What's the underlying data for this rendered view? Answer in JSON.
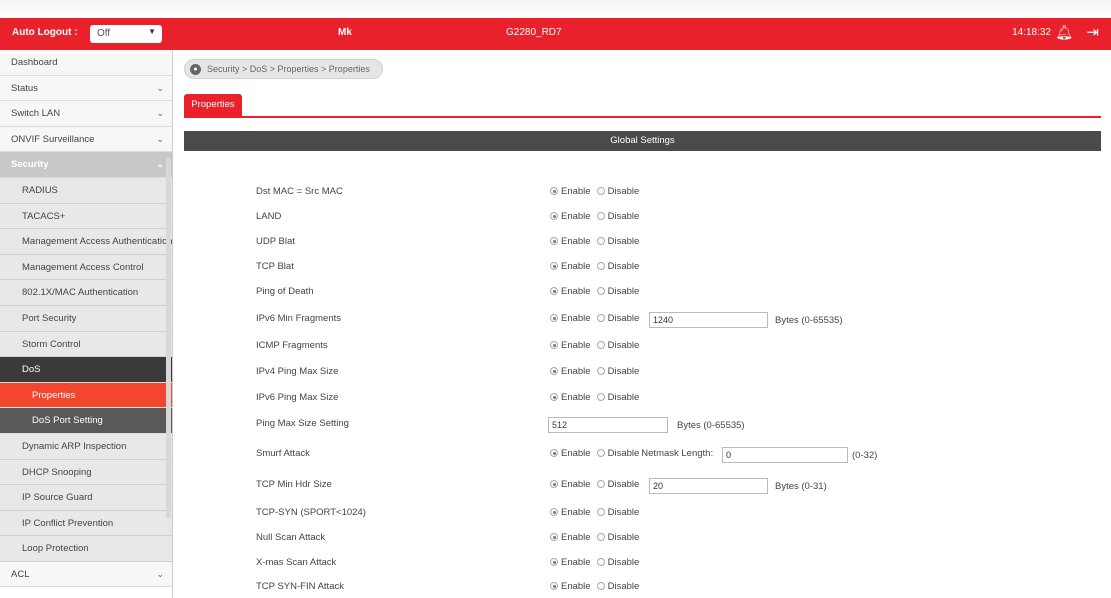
{
  "header": {
    "auto_logout_label": "Auto Logout :",
    "auto_logout_value": "Off",
    "user": "Mk",
    "model": "G2280_RD7",
    "time": "14:18:32"
  },
  "sidebar": {
    "items": [
      {
        "label": "Dashboard",
        "chevron": ""
      },
      {
        "label": "Status",
        "chevron": "⌄"
      },
      {
        "label": "Switch LAN",
        "chevron": "⌄"
      },
      {
        "label": "ONVIF Surveillance",
        "chevron": "⌄"
      },
      {
        "label": "Security",
        "chevron": "⌄"
      },
      {
        "label": "RADIUS"
      },
      {
        "label": "TACACS+"
      },
      {
        "label": "Management Access Authentication"
      },
      {
        "label": "Management Access Control"
      },
      {
        "label": "802.1X/MAC Authentication"
      },
      {
        "label": "Port Security"
      },
      {
        "label": "Storm Control"
      },
      {
        "label": "DoS"
      },
      {
        "label": "Properties"
      },
      {
        "label": "DoS Port Setting"
      },
      {
        "label": "Dynamic ARP Inspection"
      },
      {
        "label": "DHCP Snooping"
      },
      {
        "label": "IP Source Guard"
      },
      {
        "label": "IP Conflict Prevention"
      },
      {
        "label": "Loop Protection"
      },
      {
        "label": "ACL",
        "chevron": "⌄"
      }
    ]
  },
  "breadcrumb": "Security > DoS > Properties  > Properties",
  "tab": "Properties",
  "section_title": "Global Settings",
  "options": {
    "enable": "Enable",
    "disable": "Disable"
  },
  "rows": [
    {
      "label": "Dst MAC = Src MAC"
    },
    {
      "label": "LAND"
    },
    {
      "label": "UDP Blat"
    },
    {
      "label": "TCP Blat"
    },
    {
      "label": "Ping of Death"
    },
    {
      "label": "IPv6 Min Fragments",
      "value": "1240",
      "hint": "Bytes (0-65535)"
    },
    {
      "label": "ICMP Fragments"
    },
    {
      "label": "IPv4 Ping Max Size"
    },
    {
      "label": "IPv6 Ping Max Size"
    },
    {
      "label": "Ping Max Size Setting",
      "value": "512",
      "hint": "Bytes (0-65535)"
    },
    {
      "label": "Smurf Attack",
      "extra_label": "Netmask Length:",
      "value": "0",
      "hint": "(0-32)"
    },
    {
      "label": "TCP Min Hdr Size",
      "value": "20",
      "hint": "Bytes (0-31)"
    },
    {
      "label": "TCP-SYN (SPORT<1024)"
    },
    {
      "label": "Null Scan Attack"
    },
    {
      "label": "X-mas Scan Attack"
    },
    {
      "label": "TCP SYN-FIN Attack"
    }
  ],
  "colors": {
    "brand": "#e8212a",
    "active": "#f2462e"
  }
}
